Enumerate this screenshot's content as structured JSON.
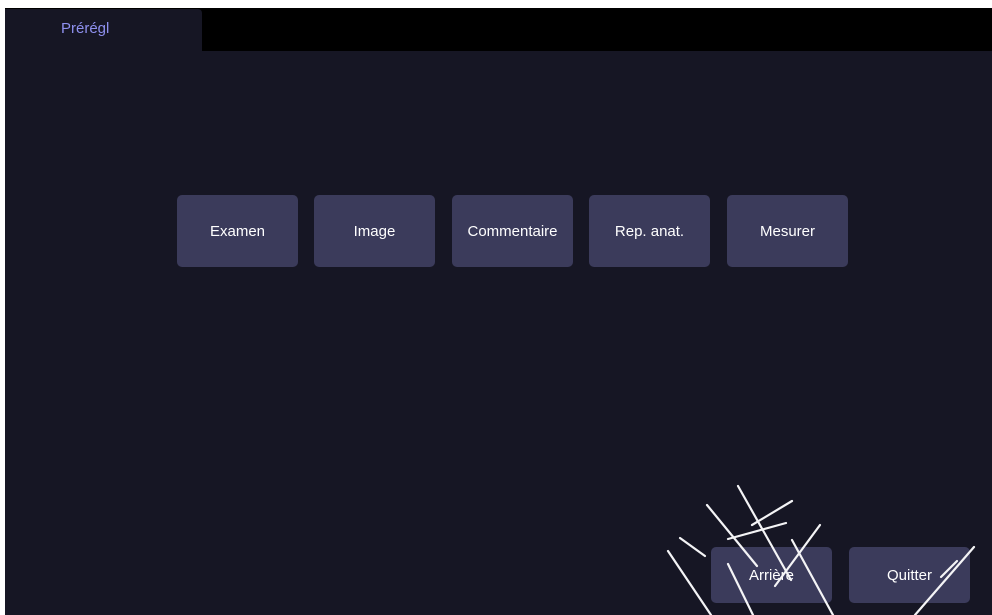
{
  "tabs": [
    {
      "label": "Prérégl",
      "active": true
    }
  ],
  "menu_buttons": [
    {
      "label": "Examen"
    },
    {
      "label": "Image"
    },
    {
      "label": "Commentaire"
    },
    {
      "label": "Rep. anat."
    },
    {
      "label": "Mesurer"
    }
  ],
  "footer": {
    "back_label": "Arrière",
    "quit_label": "Quitter"
  },
  "colors": {
    "background": "#161624",
    "tabbar": "#000000",
    "button": "#3b3b5b",
    "tab_text": "#8e90ee",
    "button_text": "#ffffff"
  }
}
